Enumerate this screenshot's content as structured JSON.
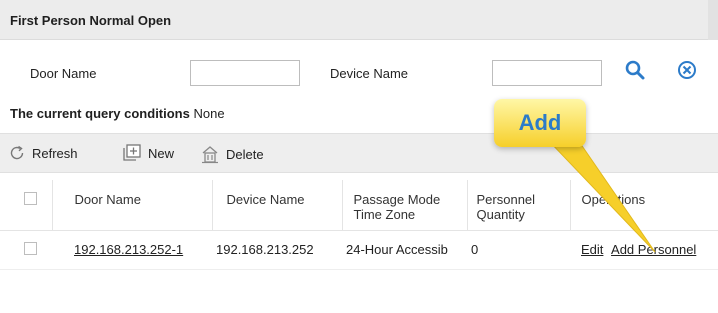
{
  "title": "First Person Normal Open",
  "query": {
    "door_name_label": "Door Name",
    "door_name_value": "",
    "device_name_label": "Device Name",
    "device_name_value": "",
    "conditions_label": "The current query conditions",
    "conditions_value": "None"
  },
  "toolbar": {
    "refresh": "Refresh",
    "new": "New",
    "delete": "Delete"
  },
  "table": {
    "headers": [
      "Door Name",
      "Device Name",
      "Passage Mode Time Zone",
      "Personnel Quantity",
      "Operations"
    ],
    "rows": [
      {
        "door_name": "192.168.213.252-1",
        "device_name": "192.168.213.252",
        "time_zone": "24-Hour Accessib",
        "quantity": "0",
        "op_edit": "Edit",
        "op_add": "Add Personnel"
      }
    ]
  },
  "callout": {
    "text": "Add"
  },
  "colors": {
    "accent": "#2c7bc9",
    "callout_fill": "#f6cf2a"
  },
  "icons": [
    "refresh-icon",
    "new-icon",
    "delete-icon",
    "search-icon",
    "clear-icon"
  ]
}
